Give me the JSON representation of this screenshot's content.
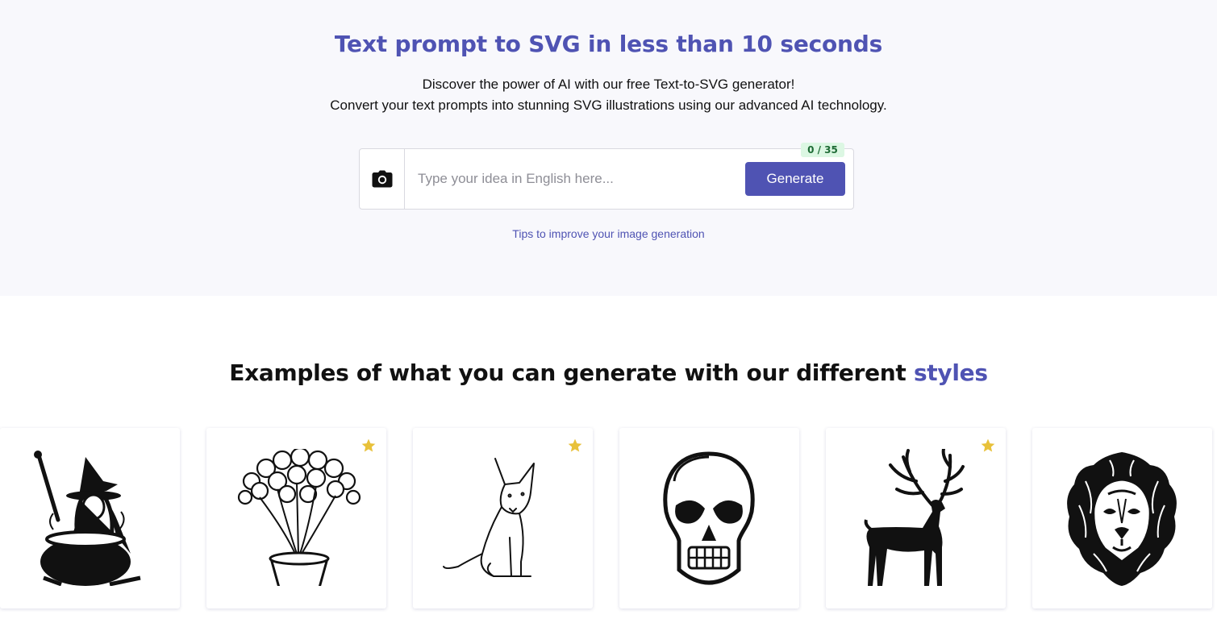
{
  "hero": {
    "title": "Text prompt to SVG in less than 10 seconds",
    "subtitle_line1": "Discover the power of AI with our free Text-to-SVG generator!",
    "subtitle_line2": "Convert your text prompts into stunning SVG illustrations using our advanced AI technology."
  },
  "prompt": {
    "placeholder": "Type your idea in English here...",
    "value": "",
    "counter": "0 / 35",
    "generate_label": "Generate",
    "camera_icon": "camera-icon"
  },
  "tips_link": "Tips to improve your image generation",
  "examples": {
    "title_main": "Examples of what you can generate with our different ",
    "title_accent": "styles",
    "cards": [
      {
        "subject": "witch-with-cauldron",
        "starred": false
      },
      {
        "subject": "flowers-in-pot",
        "starred": true
      },
      {
        "subject": "dog-line-art",
        "starred": true
      },
      {
        "subject": "skull",
        "starred": false
      },
      {
        "subject": "deer-silhouette",
        "starred": true
      },
      {
        "subject": "lion-head",
        "starred": false
      }
    ]
  },
  "colors": {
    "accent": "#4f53b3",
    "hero_background": "#f8f8fc",
    "badge_background": "#dcf7e3",
    "star": "#e8c13a"
  }
}
